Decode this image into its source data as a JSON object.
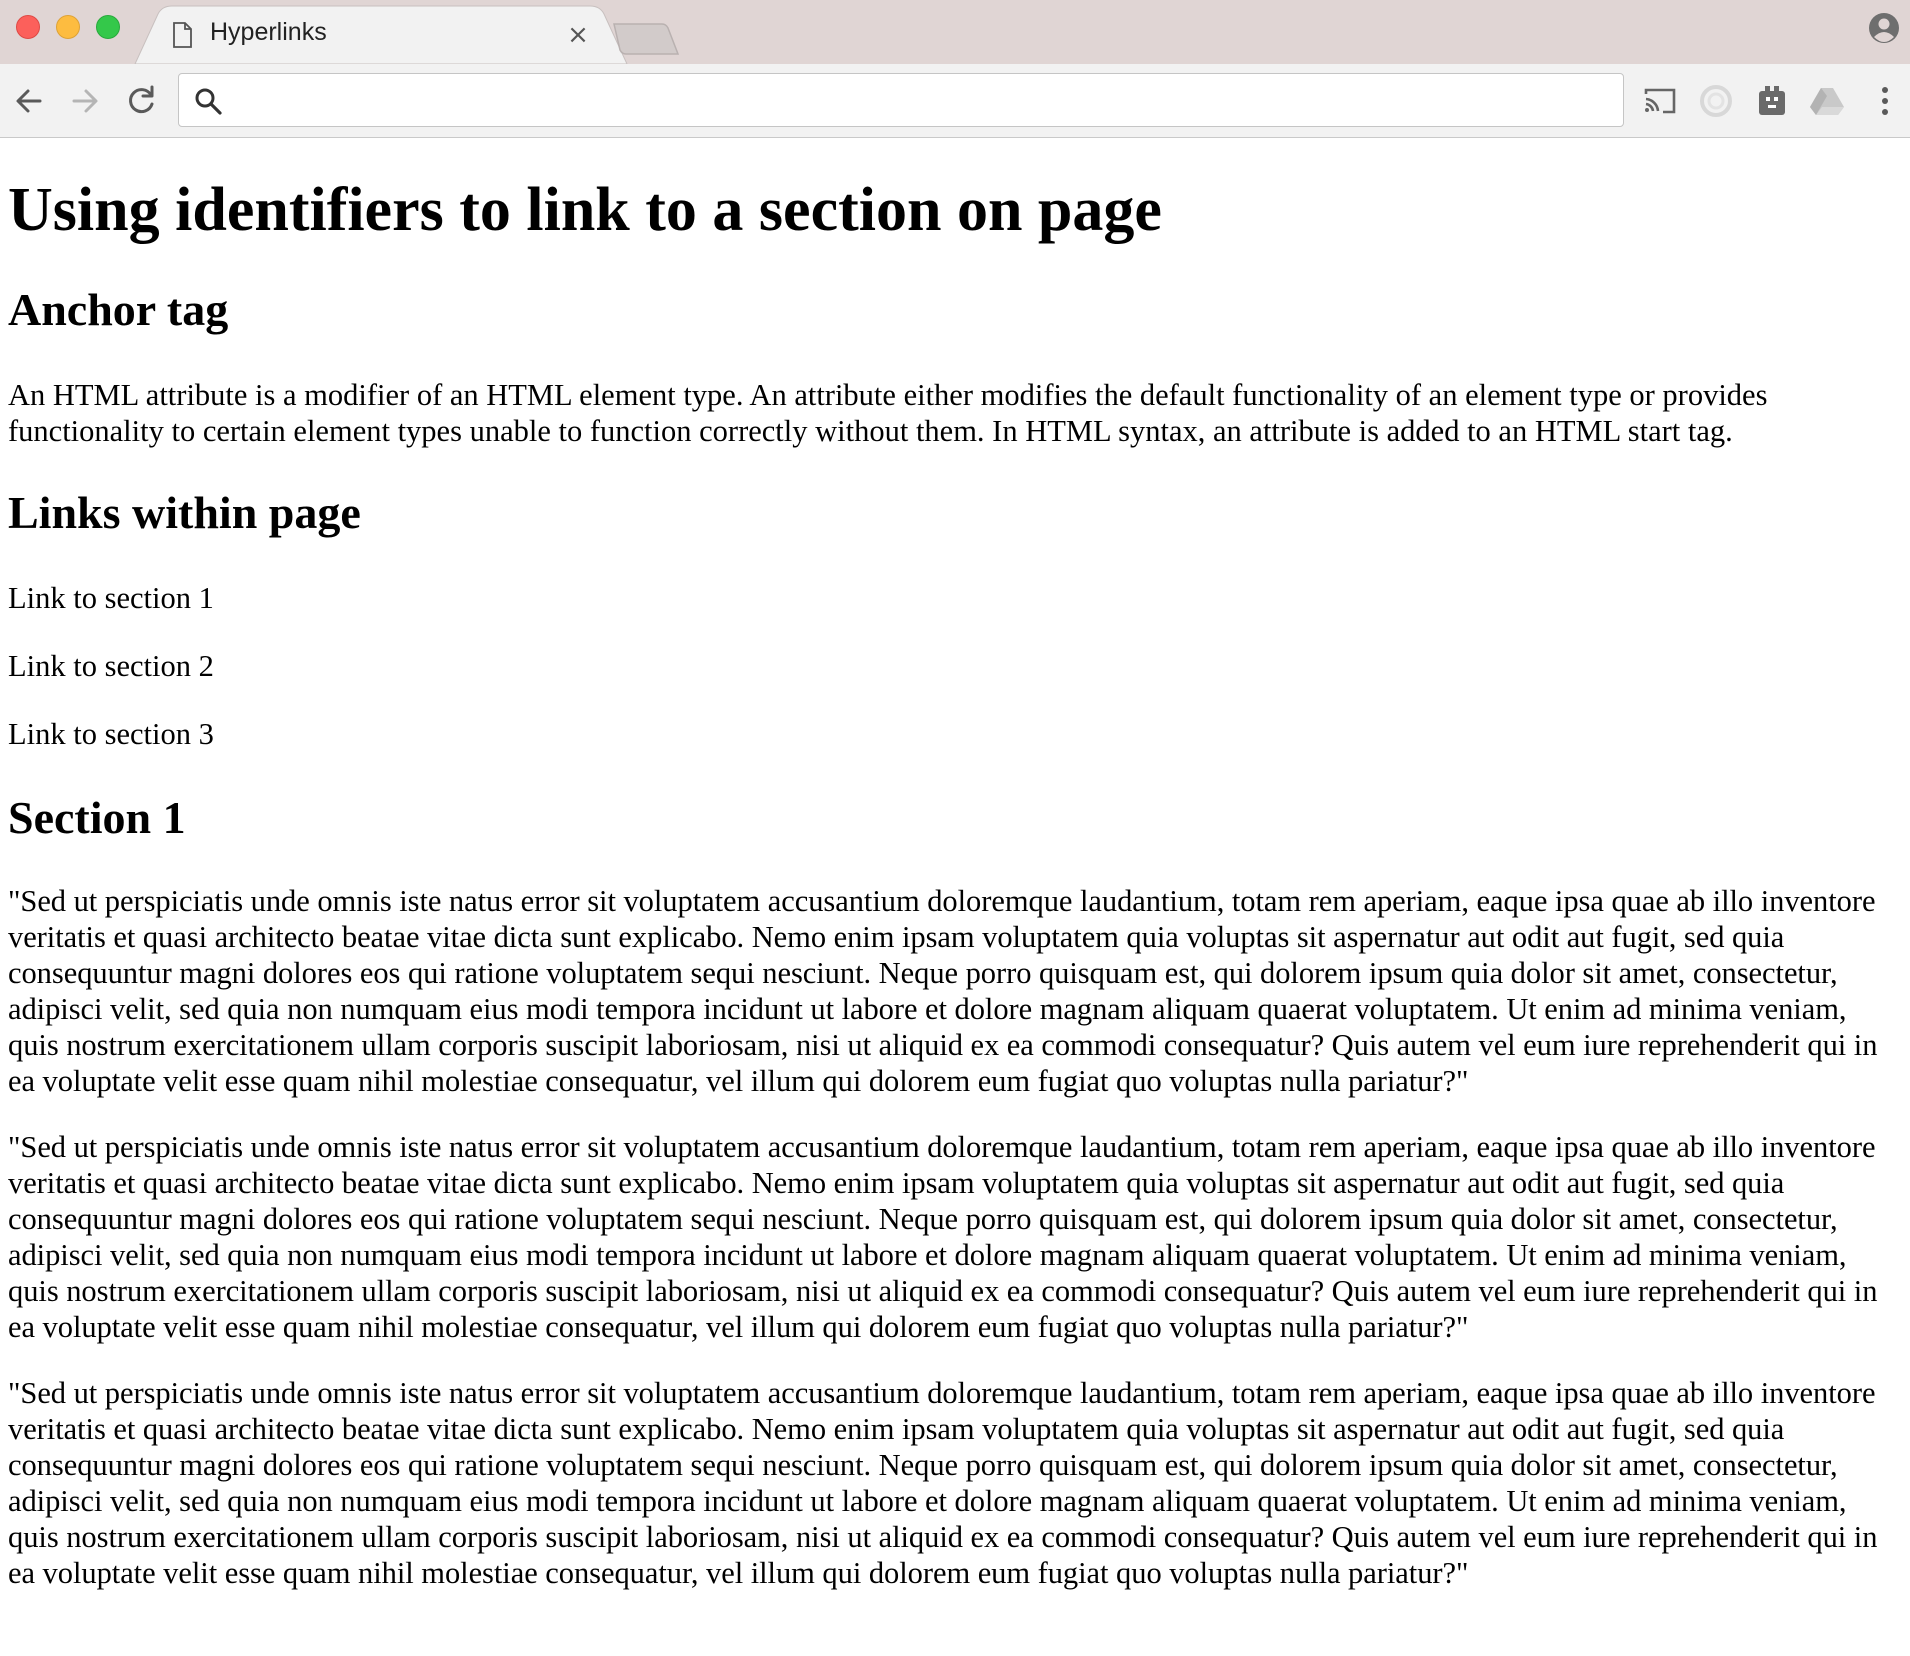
{
  "browser": {
    "tab": {
      "title": "Hyperlinks",
      "close_glyph": "×",
      "file_icon": "page-icon"
    },
    "toolbar": {
      "back_icon": "back-arrow-icon",
      "forward_icon": "forward-arrow-icon",
      "reload_icon": "reload-icon",
      "omnibox_value": "",
      "omnibox_icon": "search-icon",
      "extensions": [
        "cast-icon",
        "ring-extension-icon",
        "puzzle-extension-icon",
        "drive-icon",
        "menu-dots-icon"
      ]
    },
    "profile_icon": "profile-icon",
    "colors": {
      "tabstrip_bg": "#e0d5d4",
      "toolbar_bg": "#f2f2f2",
      "close": "#fc605b",
      "minimize": "#fdbc40",
      "maximize": "#34c84a"
    }
  },
  "page": {
    "title": "Using identifiers to link to a section on page",
    "anchor_heading": "Anchor tag",
    "anchor_text": "An HTML attribute is a modifier of an HTML element type. An attribute either modifies the default functionality of an element type or provides functionality to certain element types unable to function correctly without them. In HTML syntax, an attribute is added to an HTML start tag.",
    "links_heading": "Links within page",
    "links": [
      "Link to section 1",
      "Link to section 2",
      "Link to section 3"
    ],
    "section1_heading": "Section 1",
    "section1_paragraphs": [
      "\"Sed ut perspiciatis unde omnis iste natus error sit voluptatem accusantium doloremque laudantium, totam rem aperiam, eaque ipsa quae ab illo inventore veritatis et quasi architecto beatae vitae dicta sunt explicabo. Nemo enim ipsam voluptatem quia voluptas sit aspernatur aut odit aut fugit, sed quia consequuntur magni dolores eos qui ratione voluptatem sequi nesciunt. Neque porro quisquam est, qui dolorem ipsum quia dolor sit amet, consectetur, adipisci velit, sed quia non numquam eius modi tempora incidunt ut labore et dolore magnam aliquam quaerat voluptatem. Ut enim ad minima veniam, quis nostrum exercitationem ullam corporis suscipit laboriosam, nisi ut aliquid ex ea commodi consequatur? Quis autem vel eum iure reprehenderit qui in ea voluptate velit esse quam nihil molestiae consequatur, vel illum qui dolorem eum fugiat quo voluptas nulla pariatur?\"",
      "\"Sed ut perspiciatis unde omnis iste natus error sit voluptatem accusantium doloremque laudantium, totam rem aperiam, eaque ipsa quae ab illo inventore veritatis et quasi architecto beatae vitae dicta sunt explicabo. Nemo enim ipsam voluptatem quia voluptas sit aspernatur aut odit aut fugit, sed quia consequuntur magni dolores eos qui ratione voluptatem sequi nesciunt. Neque porro quisquam est, qui dolorem ipsum quia dolor sit amet, consectetur, adipisci velit, sed quia non numquam eius modi tempora incidunt ut labore et dolore magnam aliquam quaerat voluptatem. Ut enim ad minima veniam, quis nostrum exercitationem ullam corporis suscipit laboriosam, nisi ut aliquid ex ea commodi consequatur? Quis autem vel eum iure reprehenderit qui in ea voluptate velit esse quam nihil molestiae consequatur, vel illum qui dolorem eum fugiat quo voluptas nulla pariatur?\"",
      "\"Sed ut perspiciatis unde omnis iste natus error sit voluptatem accusantium doloremque laudantium, totam rem aperiam, eaque ipsa quae ab illo inventore veritatis et quasi architecto beatae vitae dicta sunt explicabo. Nemo enim ipsam voluptatem quia voluptas sit aspernatur aut odit aut fugit, sed quia consequuntur magni dolores eos qui ratione voluptatem sequi nesciunt. Neque porro quisquam est, qui dolorem ipsum quia dolor sit amet, consectetur, adipisci velit, sed quia non numquam eius modi tempora incidunt ut labore et dolore magnam aliquam quaerat voluptatem. Ut enim ad minima veniam, quis nostrum exercitationem ullam corporis suscipit laboriosam, nisi ut aliquid ex ea commodi consequatur? Quis autem vel eum iure reprehenderit qui in ea voluptate velit esse quam nihil molestiae consequatur, vel illum qui dolorem eum fugiat quo voluptas nulla pariatur?\""
    ]
  }
}
